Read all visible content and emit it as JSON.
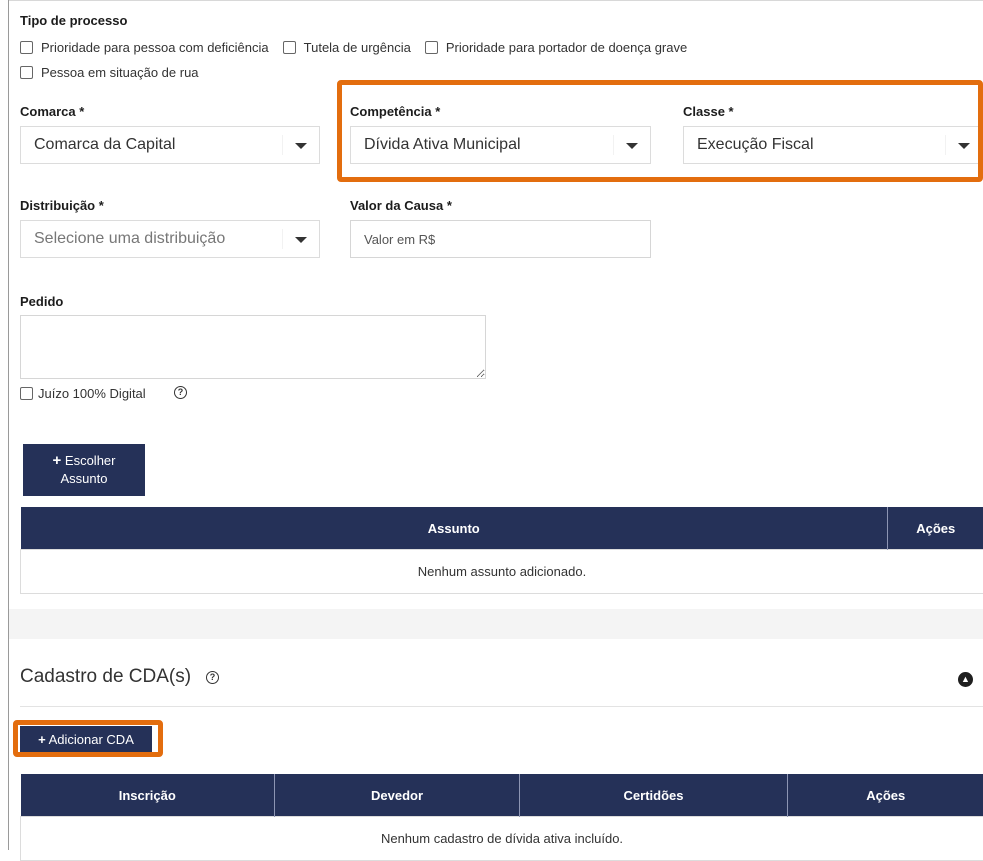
{
  "tipo_processo": {
    "label": "Tipo de processo",
    "options": [
      "Prioridade para pessoa com deficiência",
      "Tutela de urgência",
      "Prioridade para portador de doença grave",
      "Pessoa em situação de rua"
    ]
  },
  "comarca": {
    "label": "Comarca *",
    "value": "Comarca da Capital"
  },
  "competencia": {
    "label": "Competência *",
    "value": "Dívida Ativa Municipal"
  },
  "classe": {
    "label": "Classe *",
    "value": "Execução Fiscal"
  },
  "distribuicao": {
    "label": "Distribuição *",
    "placeholder": "Selecione uma distribuição"
  },
  "valor_causa": {
    "label": "Valor da Causa *",
    "placeholder": "Valor em R$"
  },
  "pedido": {
    "label": "Pedido",
    "value": ""
  },
  "juizo_digital": {
    "label": "Juízo 100% Digital",
    "help": "?"
  },
  "escolher_assunto": {
    "icon": "+",
    "line1": "Escolher",
    "line2": "Assunto"
  },
  "assunto_table": {
    "headers": [
      "Assunto",
      "Ações"
    ],
    "empty": "Nenhum assunto adicionado."
  },
  "cda": {
    "title": "Cadastro de CDA(s)",
    "help": "?",
    "add_button": {
      "icon": "+",
      "label": "Adicionar CDA"
    },
    "headers": [
      "Inscrição",
      "Devedor",
      "Certidões",
      "Ações"
    ],
    "empty": "Nenhum cadastro de dívida ativa incluído."
  },
  "colors": {
    "primary": "#253158",
    "highlight": "#e36d0e"
  }
}
